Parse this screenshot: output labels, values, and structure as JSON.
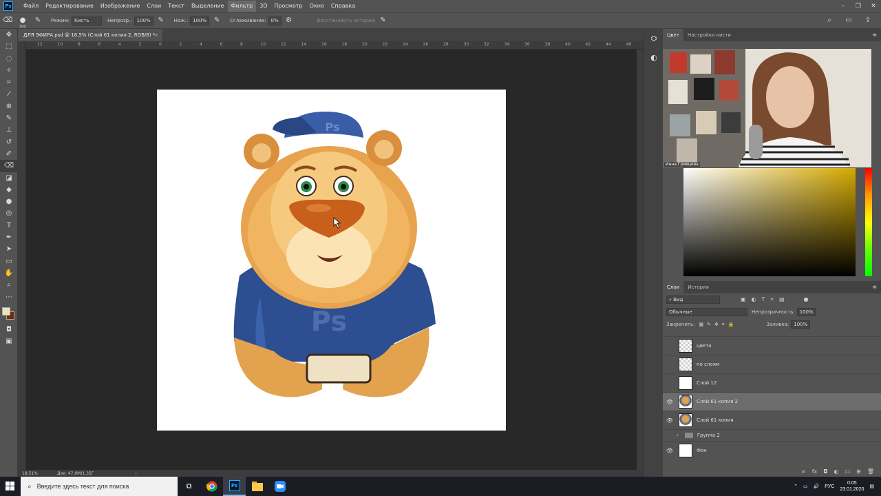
{
  "menubar": {
    "logo": "Ps",
    "items": [
      "Файл",
      "Редактирование",
      "Изображение",
      "Слои",
      "Текст",
      "Выделение",
      "Фильтр",
      "3D",
      "Просмотр",
      "Окно",
      "Справка"
    ],
    "active_item": "Фильтр"
  },
  "options": {
    "brush_size": "300",
    "mode_label": "Режим:",
    "mode_value": "Кисть",
    "opacity_label": "Непрозр.:",
    "opacity_value": "100%",
    "flow_label": "Наж.:",
    "flow_value": "100%",
    "smoothing_label": "Сглаживание:",
    "smoothing_value": "0%",
    "restore_history": "Восстановить историю"
  },
  "document": {
    "tab_title": "ДЛЯ ЭФИРА.psd @ 18,5% (Слой 61 копия 2, RGB/8) *",
    "zoom": "18,51%",
    "doc_info": "Док: 47,0M/1,35Г",
    "ruler_ticks": [
      "12",
      "10",
      "8",
      "6",
      "4",
      "2",
      "0",
      "2",
      "4",
      "6",
      "8",
      "10",
      "12",
      "14",
      "16",
      "18",
      "20",
      "22",
      "24",
      "26",
      "28",
      "30",
      "32",
      "34",
      "36",
      "38",
      "40",
      "42",
      "44",
      "46"
    ]
  },
  "panels": {
    "color_tabs": [
      "Цвет",
      "Настройки кисти"
    ],
    "webcam_label": "Инна Гривцова",
    "layers_tabs": [
      "Слои",
      "История"
    ],
    "kind_filter": "Вид",
    "blend_mode": "Обычные",
    "opacity_label": "Непрозрачность:",
    "opacity_value": "100%",
    "lock_label": "Закрепить:",
    "fill_label": "Заливка:",
    "fill_value": "100%"
  },
  "layers": [
    {
      "name": "цвета",
      "visible": false,
      "thumb": "checker",
      "selected": false
    },
    {
      "name": "по слоям",
      "visible": false,
      "thumb": "checker",
      "selected": false
    },
    {
      "name": "Слой 12",
      "visible": false,
      "thumb": "sketch",
      "selected": false
    },
    {
      "name": "Слой 61 копия 2",
      "visible": true,
      "thumb": "lion",
      "selected": true
    },
    {
      "name": "Слой 61 копия",
      "visible": true,
      "thumb": "lion",
      "selected": false
    },
    {
      "name": "Группа 2",
      "visible": false,
      "thumb": "folder",
      "selected": false
    },
    {
      "name": "Фон",
      "visible": true,
      "thumb": "white",
      "selected": false
    }
  ],
  "colors": {
    "foreground": "#efe2b9",
    "background": "#6b2d06"
  },
  "taskbar": {
    "search_placeholder": "Введите здесь текст для поиска",
    "apps": [
      "task-view",
      "chrome",
      "photoshop",
      "file-explorer",
      "zoom"
    ],
    "lang": "РУС",
    "time": "0:05",
    "date": "23.01.2020"
  }
}
